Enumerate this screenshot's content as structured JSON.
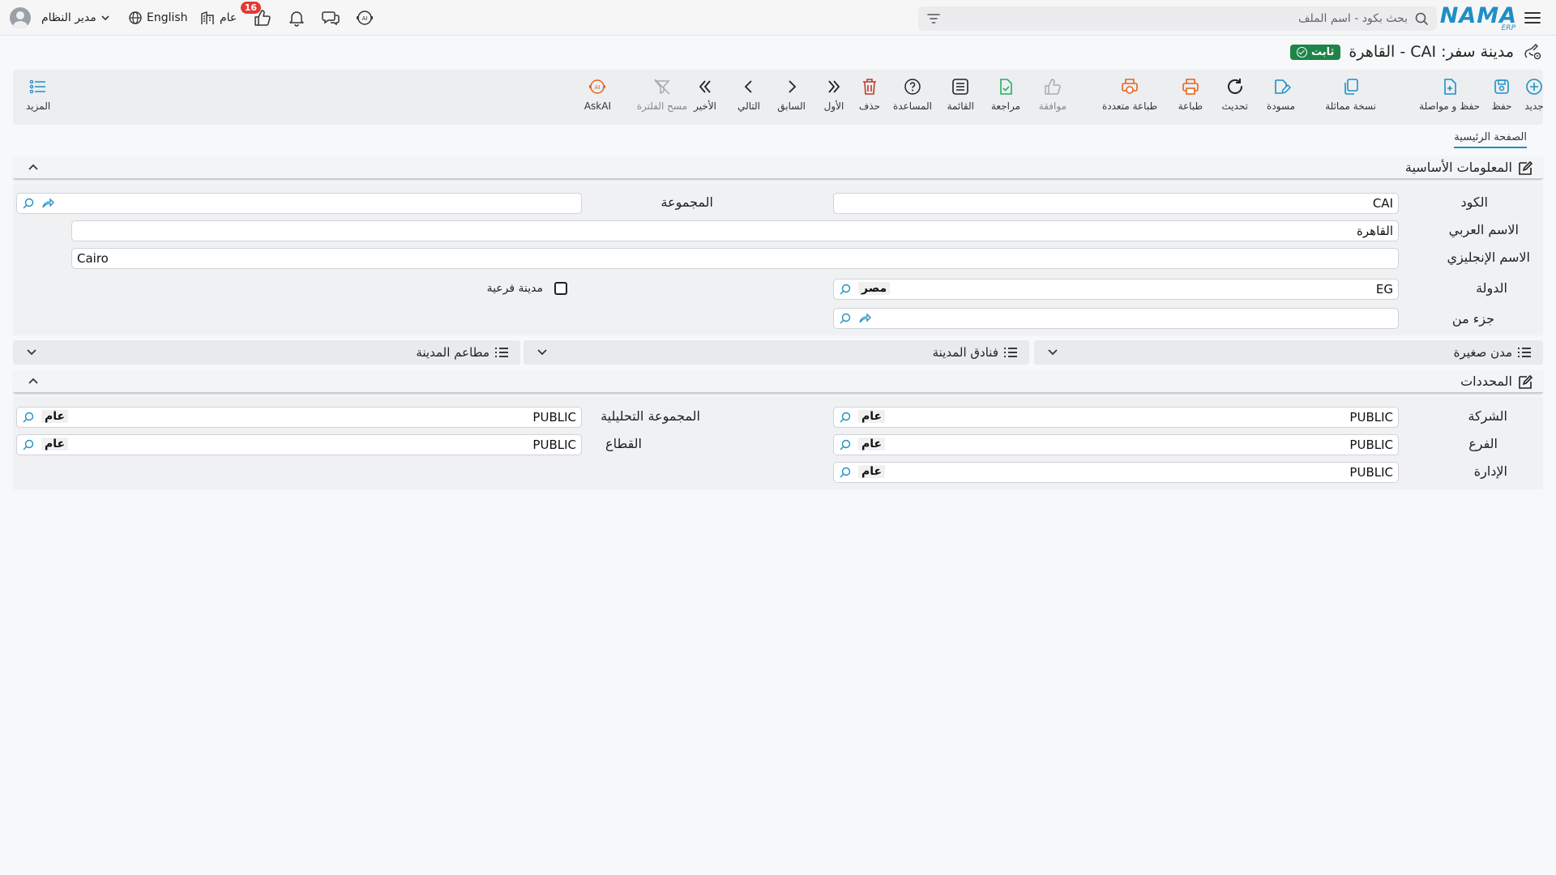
{
  "topbar": {
    "logo_text": "NAMA",
    "logo_sub": "ERP",
    "search_placeholder": "بحث بكود - اسم الملف",
    "notifications_count": "16",
    "public_label": "عام",
    "language_label": "English",
    "user_label": "مدير النظام"
  },
  "title": {
    "text": "مدينة سفر: CAI - القاهرة",
    "status": "ثابت"
  },
  "toolbar": {
    "new": "جديد",
    "save": "حفظ",
    "save_continue": "حفظ و مواصلة",
    "duplicate": "نسخة مماثلة",
    "draft": "مسودة",
    "refresh": "تحديث",
    "print": "طباعة",
    "multi_print": "طباعة متعددة",
    "approve": "موافقة",
    "review": "مراجعة",
    "list": "القائمة",
    "help": "المساعدة",
    "delete": "حذف",
    "first": "الأول",
    "prev": "السابق",
    "next": "التالي",
    "last": "الأخير",
    "clear_filter": "مسح الفلترة",
    "askai": "AskAI",
    "more": "المزيد"
  },
  "tabs": {
    "main": "الصفحة الرئيسية"
  },
  "basic_info": {
    "header": "المعلومات الأساسية",
    "code_label": "الكود",
    "code_value": "CAI",
    "group_label": "المجموعة",
    "group_value": "",
    "arabic_name_label": "الاسم العربي",
    "arabic_name_value": "القاهرة",
    "english_name_label": "الاسم الإنجليزي",
    "english_name_value": "Cairo",
    "country_label": "الدولة",
    "country_code": "EG",
    "country_name": "مصر",
    "sub_city_label": "مدينة فرعية",
    "part_of_label": "جزء من",
    "part_of_value": ""
  },
  "collapsed": {
    "small_cities": "مدن صغيرة",
    "city_hotels": "فنادق المدينة",
    "city_restaurants": "مطاعم المدينة"
  },
  "dimensions": {
    "header": "المحددات",
    "company_label": "الشركة",
    "company_code": "PUBLIC",
    "company_name": "عام",
    "branch_label": "الفرع",
    "branch_code": "PUBLIC",
    "branch_name": "عام",
    "department_label": "الإدارة",
    "department_code": "PUBLIC",
    "department_name": "عام",
    "analysis_group_label": "المجموعة التحليلية",
    "analysis_group_code": "PUBLIC",
    "analysis_group_name": "عام",
    "sector_label": "القطاع",
    "sector_code": "PUBLIC",
    "sector_name": "عام"
  },
  "colors": {
    "accent": "#1e8fc6",
    "status_green": "#1e8449",
    "print_orange": "#e8621c",
    "delete_red": "#c0392b",
    "review_green": "#27ae60"
  }
}
